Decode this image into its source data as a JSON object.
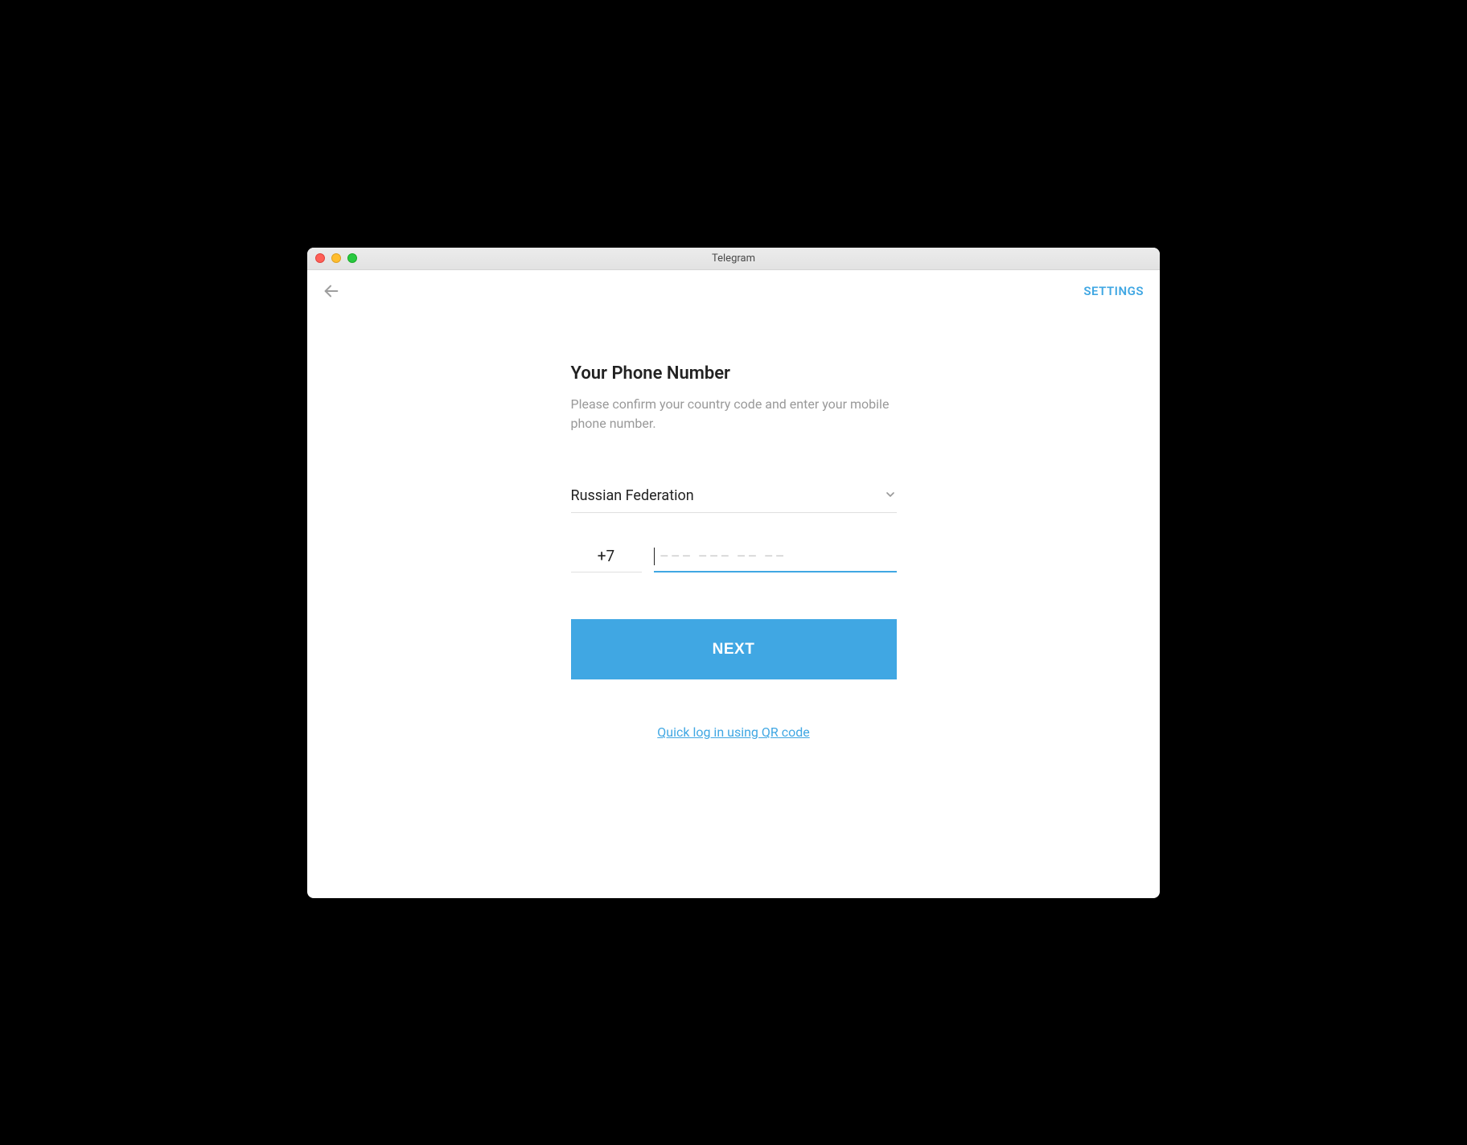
{
  "window": {
    "title": "Telegram"
  },
  "topbar": {
    "settings_label": "SETTINGS"
  },
  "form": {
    "heading": "Your Phone Number",
    "subtext": "Please confirm your country code and enter your mobile phone number.",
    "country": "Russian Federation",
    "code": "+7",
    "phone_placeholder": "––– ––– –– ––",
    "next_label": "NEXT",
    "qr_link": "Quick log in using QR code"
  },
  "colors": {
    "accent": "#40a7e3"
  }
}
